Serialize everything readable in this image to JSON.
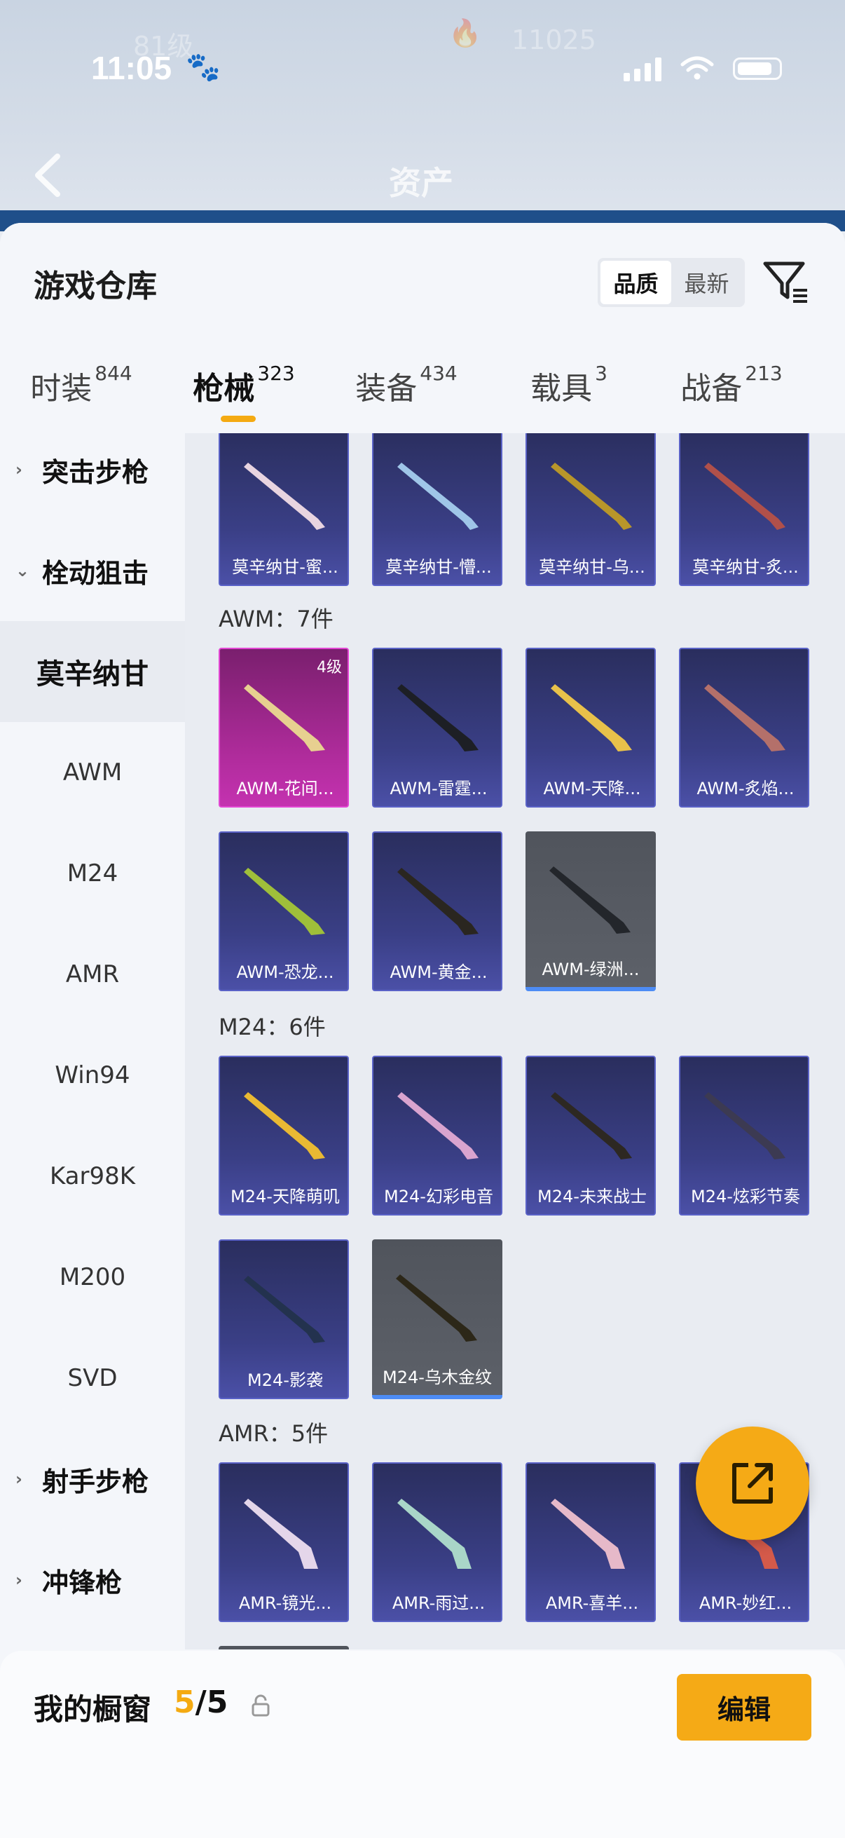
{
  "status": {
    "time": "11:05"
  },
  "background": {
    "title": "资产"
  },
  "sheet": {
    "title": "游戏仓库",
    "sort_options": [
      "品质",
      "最新"
    ]
  },
  "tabs": [
    {
      "name": "时装",
      "count": "844"
    },
    {
      "name": "枪械",
      "count": "323"
    },
    {
      "name": "装备",
      "count": "434"
    },
    {
      "name": "载具",
      "count": "3"
    },
    {
      "name": "战备",
      "count": "213"
    }
  ],
  "categories": [
    {
      "label": "突击步枪",
      "type": "group",
      "expanded": false
    },
    {
      "label": "栓动狙击",
      "type": "group",
      "expanded": true
    },
    {
      "label": "莫辛纳甘",
      "type": "sub",
      "selected": true
    },
    {
      "label": "AWM",
      "type": "sub"
    },
    {
      "label": "M24",
      "type": "sub"
    },
    {
      "label": "AMR",
      "type": "sub"
    },
    {
      "label": "Win94",
      "type": "sub"
    },
    {
      "label": "Kar98K",
      "type": "sub"
    },
    {
      "label": "M200",
      "type": "sub"
    },
    {
      "label": "SVD",
      "type": "sub"
    },
    {
      "label": "射手步枪",
      "type": "group",
      "expanded": false
    },
    {
      "label": "冲锋枪",
      "type": "group",
      "expanded": false
    }
  ],
  "sections": {
    "mosin": {
      "items": [
        "莫辛纳甘-蜜...",
        "莫辛纳甘-懵...",
        "莫辛纳甘-乌...",
        "莫辛纳甘-炙..."
      ]
    },
    "awm": {
      "title": "AWM：7件",
      "items": [
        "AWM-花间...",
        "AWM-雷霆...",
        "AWM-天降...",
        "AWM-炙焰...",
        "AWM-恐龙...",
        "AWM-黄金...",
        "AWM-绿洲..."
      ],
      "level_badge": "4级"
    },
    "m24": {
      "title": "M24：6件",
      "items": [
        "M24-天降萌叽",
        "M24-幻彩电音",
        "M24-未来战士",
        "M24-炫彩节奏",
        "M24-影袭",
        "M24-乌木金纹"
      ]
    },
    "amr": {
      "title": "AMR：5件",
      "items": [
        "AMR-镜光...",
        "AMR-雨过...",
        "AMR-喜羊...",
        "AMR-妙红..."
      ]
    }
  },
  "showcase": {
    "label": "我的橱窗",
    "current": "5",
    "total": "/5"
  },
  "edit_button": "编辑",
  "colors": {
    "accent": "#f5aa16",
    "card_purple": "#3a3f86",
    "card_pink": "#b12c9d",
    "card_grey": "#5d6169"
  }
}
